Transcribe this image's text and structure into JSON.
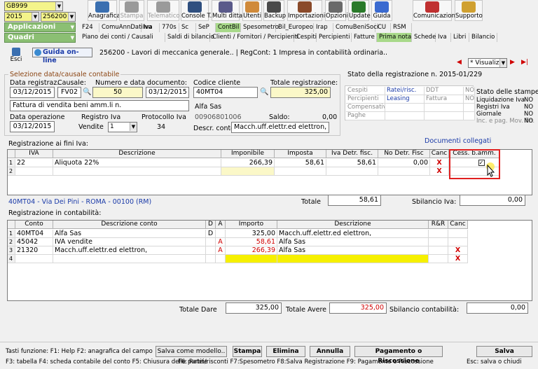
{
  "selectors": {
    "user": "GB999",
    "year": "2015",
    "company": "256200 -",
    "applications": "Applicazioni",
    "frames": "Quadri"
  },
  "toolbar": [
    {
      "label": "Anagrafica",
      "icon": "address-book-icon",
      "color": "#3a6fb0",
      "disabled": false
    },
    {
      "label": "Stampa",
      "icon": "printer-icon",
      "color": "#9a9a9a",
      "disabled": true
    },
    {
      "label": "Telematico",
      "icon": "telematic-icon",
      "color": "#9a9a9a",
      "disabled": true
    },
    {
      "label": "Console T.",
      "icon": "console-icon",
      "color": "#2f4f7f",
      "disabled": false
    },
    {
      "label": "Multi ditta",
      "icon": "multi-company-icon",
      "color": "#5a5a8a",
      "disabled": false
    },
    {
      "label": "Utenti",
      "icon": "users-icon",
      "color": "#d08a3a",
      "disabled": false
    },
    {
      "label": "Backup",
      "icon": "backup-icon",
      "color": "#4a4a4a",
      "disabled": false
    },
    {
      "label": "Importazioni",
      "icon": "import-icon",
      "color": "#8a4a2a",
      "disabled": false
    },
    {
      "label": "Opzioni",
      "icon": "options-icon",
      "color": "#6a6a6a",
      "disabled": false
    },
    {
      "label": "Update",
      "icon": "update-icon",
      "color": "#2a7a2a",
      "disabled": false
    },
    {
      "label": "Guida",
      "icon": "help-icon",
      "color": "#3a6ad0",
      "disabled": false
    },
    {
      "label": "Comunicazioni",
      "icon": "communications-icon",
      "color": "#c03030",
      "disabled": false
    },
    {
      "label": "Supporto",
      "icon": "support-icon",
      "color": "#d0a030",
      "disabled": false
    }
  ],
  "menu_row1": [
    "F24",
    "ComuAnnDatiIva",
    "Iva",
    "770s",
    "Sc",
    "SeP",
    "ContBil",
    "Spesometro",
    "Bil_Europeo",
    "Irap",
    "ComuBeniSoci",
    "CU",
    "RSM"
  ],
  "menu_row2": [
    "Piano dei conti / Causali",
    "Saldi di bilancio",
    "Clienti / Fornitori / Percipienti",
    "Cespiti",
    "Percipienti",
    "Fatture",
    "Prima nota",
    "Schede",
    "Iva",
    "Libri",
    "Bilancio"
  ],
  "subheader": {
    "exit": "Esci",
    "guide": "Guida on-line",
    "title": "256200 - Lavori di meccanica generale.. | RegCont: 1 Impresa  in contabilità ordinaria..",
    "view": "* Visualizz"
  },
  "selection": {
    "section_title": "Selezione data/causale contabile",
    "reg_date_label": "Data registraz.",
    "reg_date": "03/12/2015",
    "causal_label": "Causale:",
    "causal": "FV02",
    "doc_label": "Numero e data documento:",
    "doc_number": "50",
    "doc_date": "03/12/2015",
    "description": "Fattura di vendita beni amm.li n.",
    "op_date_label": "Data operazione",
    "op_date": "03/12/2015",
    "vat_register_label": "Registro Iva",
    "vat_register": "Vendite",
    "vat_register_select": "1",
    "protocol_label": "Protocollo Iva",
    "protocol": "34",
    "customer_code_label": "Codice cliente",
    "customer_code": "40MT04",
    "total_label": "Totale registrazione:",
    "total": "325,00",
    "customer_name": "Alfa Sas",
    "customer_vat": "00906801006",
    "balance_label": "Saldo:",
    "balance": "0,00",
    "account_desc_label": "Descr. conto",
    "account_desc": "Macch.uff.elettr.ed elettron,"
  },
  "status": {
    "title": "Stato della registrazione n. 2015-01/229",
    "grid": [
      [
        "Cespiti",
        "Ratei/risc.",
        "DDT",
        "NO"
      ],
      [
        "Percipienti",
        "Leasing",
        "Fattura",
        "NO"
      ],
      [
        "Compensativi",
        "",
        "",
        ""
      ],
      [
        "Paghe",
        "",
        "",
        ""
      ]
    ],
    "prints_title": "Stato delle stampe:",
    "prints": [
      [
        "Liquidazione Iva",
        "NO"
      ],
      [
        "Registri Iva",
        "NO"
      ],
      [
        "Giornale",
        "NO"
      ],
      [
        "Inc. e pag. Mov. fin.",
        "NO"
      ]
    ]
  },
  "docs_link": "Documenti collegati",
  "vat": {
    "title": "Registrazione ai fini Iva:",
    "headers": [
      "IVA",
      "Descrizione",
      "Imponibile",
      "Imposta",
      "Iva Detr. fisc.",
      "No Detr. Fisc",
      "Canc",
      "Cess. b.amm."
    ],
    "rows": [
      {
        "n": "1",
        "iva": "22",
        "desc": "Aliquota 22%",
        "imp": "266,39",
        "tax": "58,61",
        "detr": "58,61",
        "nodetr": "0,00",
        "canc": "X",
        "cess": true
      },
      {
        "n": "2",
        "iva": "",
        "desc": "",
        "imp": "",
        "tax": "",
        "detr": "",
        "nodetr": "",
        "canc": "X",
        "cess": false
      }
    ],
    "address": "40MT04 - Via Dei Pini - ROMA - 00100 (RM)",
    "total_label": "Totale",
    "total": "58,61",
    "unbalance_label": "Sbilancio Iva:",
    "unbalance": "0,00"
  },
  "accounting": {
    "title": "Registrazione in contabilità:",
    "headers": [
      "Conto",
      "Descrizione conto",
      "D",
      "A",
      "Importo",
      "Descrizione",
      "R&R",
      "Canc"
    ],
    "rows": [
      {
        "n": "1",
        "conto": "40MT04",
        "desc": "Alfa Sas",
        "d": "D",
        "a": "",
        "imp": "325,00",
        "descr": "Macch.uff.elettr.ed elettron,",
        "canc": ""
      },
      {
        "n": "2",
        "conto": "45042",
        "desc": "IVA vendite",
        "d": "",
        "a": "A",
        "imp": "58,61",
        "descr": "Alfa Sas",
        "canc": ""
      },
      {
        "n": "3",
        "conto": "21320",
        "desc": "Macch.uff.elettr.ed elettron,",
        "d": "",
        "a": "A",
        "imp": "266,39",
        "descr": "Alfa Sas",
        "canc": "X"
      },
      {
        "n": "4",
        "conto": "",
        "desc": "",
        "d": "",
        "a": "",
        "imp": "",
        "descr": "",
        "canc": "X"
      }
    ],
    "total_dare_label": "Totale Dare",
    "total_dare": "325,00",
    "total_avere_label": "Totale Avere",
    "total_avere": "325,00",
    "unbalance_label": "Sbilancio contabilità:",
    "unbalance": "0,00"
  },
  "footer": {
    "keys1": "Tasti funzione: F1: Help  F2: anagrafica del campo",
    "keys2": "F3: tabella   F4: scheda contabile del conto  F5: Chiusura delle partite",
    "keys3": "F6: Ratei/risconti  F7:Spesometro  F8:Salva Registrazione   F9: Pagamento o Riscossione",
    "keys4": "Esc: salva o chiudi",
    "save_model": "Salva come modello..",
    "print": "Stampa",
    "delete": "Elimina",
    "cancel": "Annulla",
    "payment": "Pagamento o Riscossione",
    "save": "Salva"
  }
}
